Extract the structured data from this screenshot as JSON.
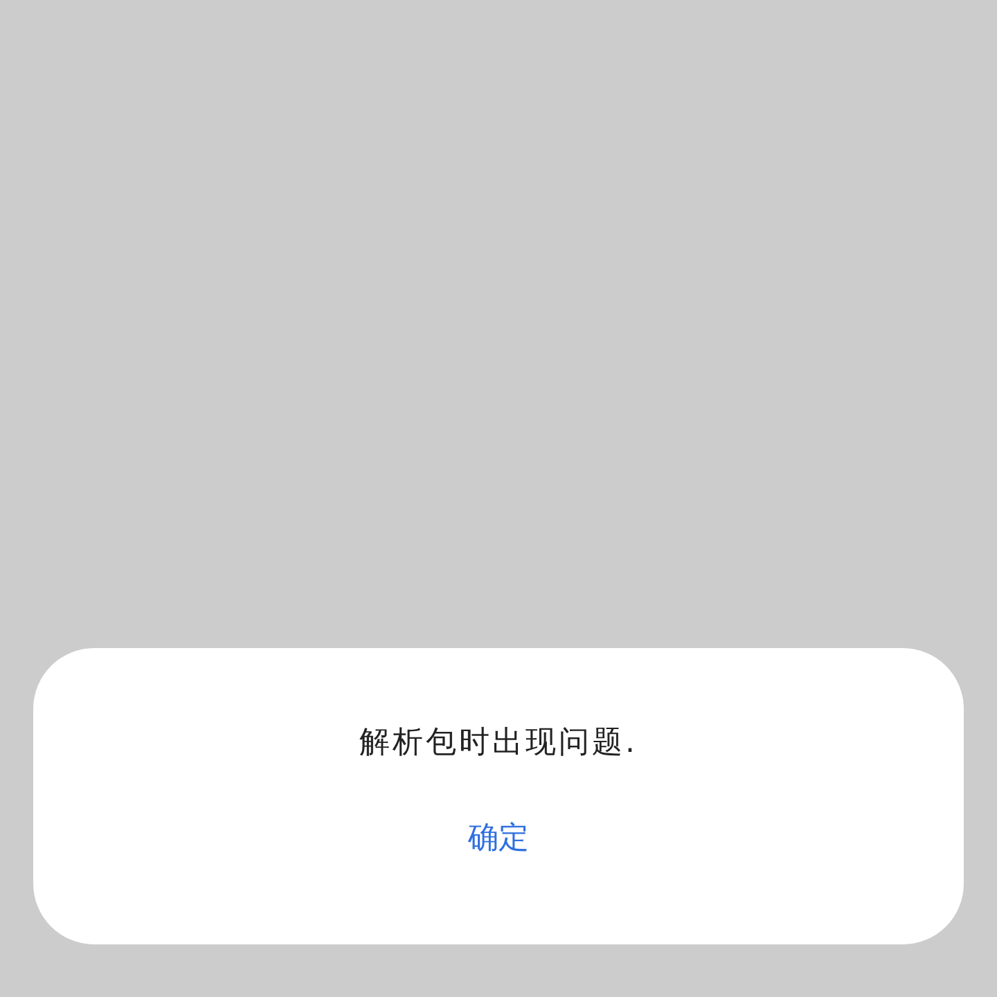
{
  "dialog": {
    "message": "解析包时出现问题.",
    "buttons": [
      "确定"
    ]
  }
}
